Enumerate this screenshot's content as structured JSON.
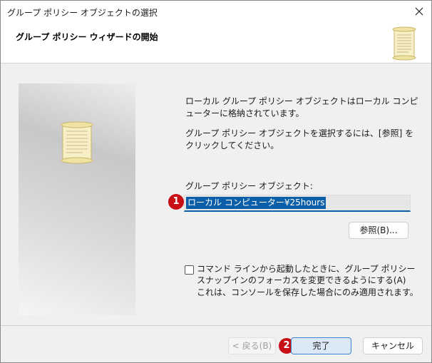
{
  "window": {
    "title": "グループ ポリシー オブジェクトの選択",
    "close_icon": "close-icon"
  },
  "header": {
    "title": "グループ ポリシー ウィザードの開始",
    "icon": "scroll-icon"
  },
  "main": {
    "text1": "ローカル グループ ポリシー オブジェクトはローカル コンピューターに格納されています。",
    "text2": "グループ ポリシー オブジェクトを選択するには、[参照] をクリックしてください。",
    "gpo_label": "グループ ポリシー オブジェクト:",
    "gpo_value": "ローカル コンピューター¥25hours",
    "browse_label": "参照(B)...",
    "checkbox_label": "コマンド ラインから起動したときに、グループ ポリシー スナップインのフォーカスを変更できるようにする(A)",
    "checkbox_note": "これは、コンソールを保存した場合にのみ適用されます。",
    "checkbox_checked": false
  },
  "footer": {
    "back_label": "< 戻る(B)",
    "finish_label": "完了",
    "cancel_label": "キャンセル"
  },
  "annotations": {
    "badge1": "1",
    "badge2": "2",
    "badge_color": "#c80f16"
  },
  "colors": {
    "accent": "#0a5fa8",
    "finish_bg": "#dbe9f7",
    "finish_border": "#3b86d4"
  }
}
